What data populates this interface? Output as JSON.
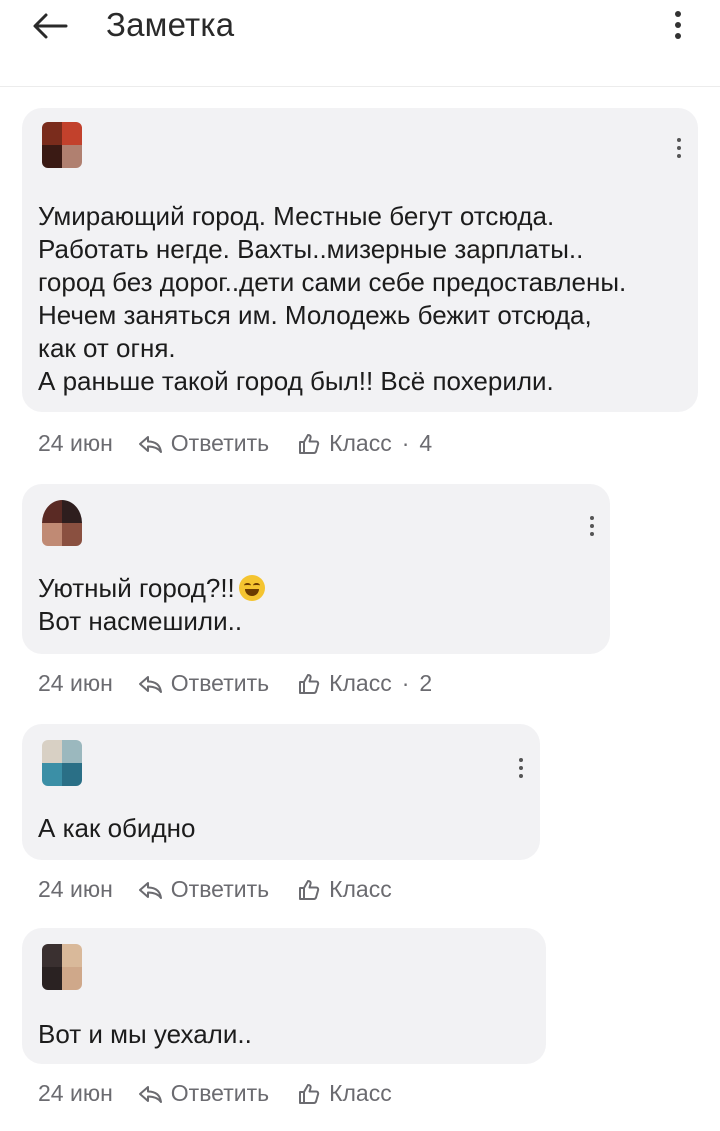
{
  "app_bar": {
    "title": "Заметка",
    "back_icon": "arrow-left-icon",
    "menu_icon": "more-vertical-icon"
  },
  "comments": [
    {
      "author": "",
      "text_lines": [
        "Умирающий город. Местные бегут отсюда.",
        "Работать негде. Вахты..мизерные зарплаты..",
        "город без дорог..дети сами себе предоставлены.",
        "Нечем заняться им. Молодежь бежит отсюда,",
        "как от огня.",
        "А раньше такой город был!! Всё похерили."
      ],
      "date": "24 июн",
      "reply_label": "Ответить",
      "like_label": "Класс",
      "like_count": "4"
    },
    {
      "author": "",
      "text_lines": [
        "Уютный город?!!",
        "Вот насмешили.."
      ],
      "emoji": "face-with-tears-of-joy",
      "date": "24 июн",
      "reply_label": "Ответить",
      "like_label": "Класс",
      "like_count": "2"
    },
    {
      "author": "",
      "text_lines": [
        "А как обидно"
      ],
      "date": "24 июн",
      "reply_label": "Ответить",
      "like_label": "Класс",
      "like_count": ""
    },
    {
      "author": "",
      "text_lines": [
        "Вот и мы уехали.."
      ],
      "date": "24 июн",
      "reply_label": "Ответить",
      "like_label": "Класс",
      "like_count": ""
    }
  ],
  "colors": {
    "bubble": "#f2f2f4",
    "text": "#1c1c1c",
    "meta": "#6b6b70"
  }
}
